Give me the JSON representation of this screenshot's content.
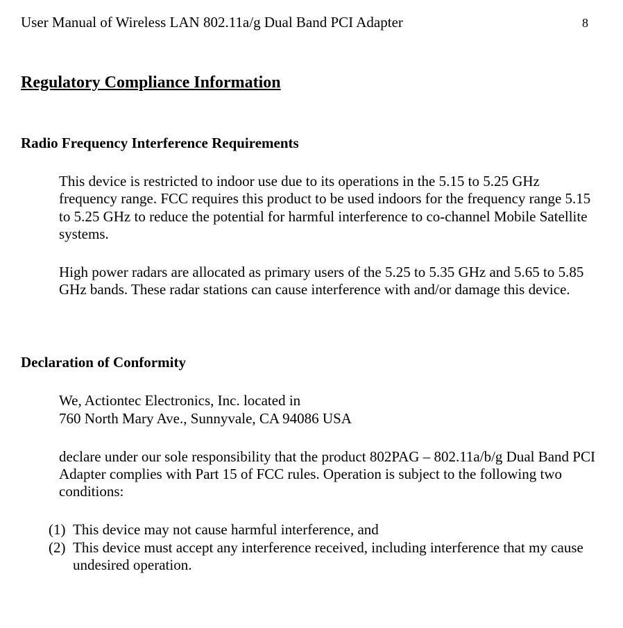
{
  "header": {
    "title": "User Manual of Wireless LAN 802.11a/g Dual Band PCI Adapter",
    "page_number": "8"
  },
  "section_title": "Regulatory Compliance Information",
  "rf_section": {
    "title": "Radio Frequency Interference Requirements",
    "para1": "This device is restricted to indoor use due to its operations in the 5.15 to 5.25 GHz frequency range.  FCC requires this product to be used indoors for the frequency range 5.15 to 5.25 GHz to reduce the potential for harmful interference to co-channel Mobile Satellite systems.",
    "para2": "High power radars are allocated as primary users of the 5.25 to 5.35 GHz and 5.65 to 5.85 GHz bands.  These radar stations can cause interference with and/or damage this device."
  },
  "doc_section": {
    "title": "Declaration of Conformity",
    "para1_line1": "We, Actiontec Electronics, Inc. located in",
    "para1_line2": "760 North Mary Ave., Sunnyvale, CA 94086 USA",
    "para2": "declare under our sole responsibility that the product 802PAG – 802.11a/b/g Dual Band PCI Adapter complies with Part 15 of FCC rules.  Operation is subject to the following two conditions:",
    "list": {
      "item1_marker": "(1)",
      "item1_text": "This device may not cause harmful interference, and",
      "item2_marker": "(2)",
      "item2_text": "This device must accept any interference received, including interference that my cause undesired operation."
    }
  }
}
